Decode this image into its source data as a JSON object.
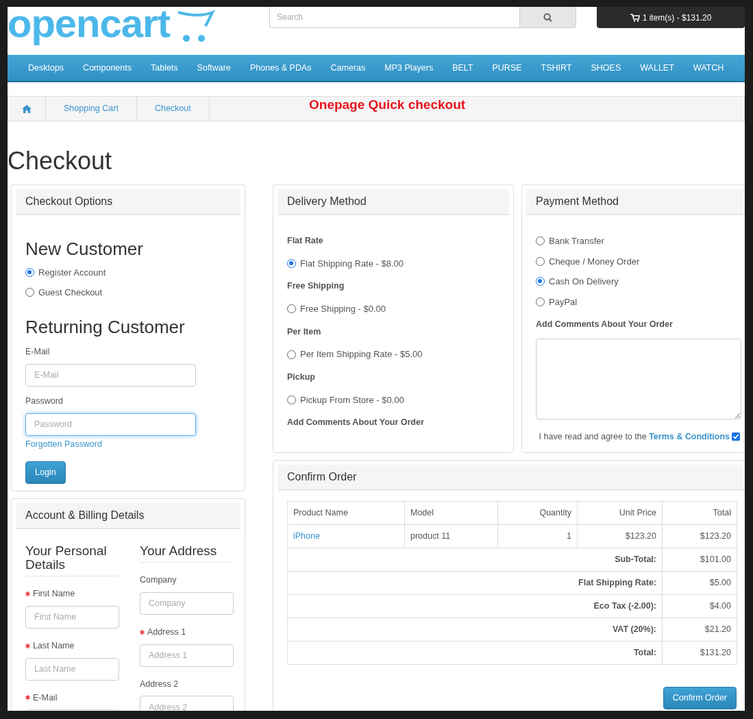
{
  "logo": {
    "text": "opencart"
  },
  "search": {
    "placeholder": "Search"
  },
  "cart": {
    "label": "1 item(s) - $131.20"
  },
  "nav": [
    "Desktops",
    "Components",
    "Tablets",
    "Software",
    "Phones & PDAs",
    "Cameras",
    "MP3 Players",
    "BELT",
    "PURSE",
    "TSHIRT",
    "SHOES",
    "WALLET",
    "WATCH"
  ],
  "breadcrumb": [
    "Shopping Cart",
    "Checkout"
  ],
  "banner": "Onepage Quick checkout",
  "page_title": "Checkout",
  "checkout_options": {
    "title": "Checkout Options",
    "new_customer": {
      "heading": "New Customer",
      "options": [
        {
          "label": "Register Account",
          "selected": true
        },
        {
          "label": "Guest Checkout",
          "selected": false
        }
      ]
    },
    "returning_customer": {
      "heading": "Returning Customer",
      "fields": [
        {
          "label": "E-Mail",
          "placeholder": "E-Mail",
          "focused": false
        },
        {
          "label": "Password",
          "placeholder": "Password",
          "focused": true
        }
      ],
      "forgotten_link": "Forgotten Password",
      "login_button": "Login"
    }
  },
  "account_billing": {
    "title": "Account & Billing Details",
    "personal": {
      "heading": "Your Personal Details",
      "fields": [
        {
          "label": "First Name",
          "placeholder": "First Name",
          "required": true
        },
        {
          "label": "Last Name",
          "placeholder": "Last Name",
          "required": true
        },
        {
          "label": "E-Mail",
          "required": true
        }
      ]
    },
    "address": {
      "heading": "Your Address",
      "fields": [
        {
          "label": "Company",
          "placeholder": "Company",
          "required": false
        },
        {
          "label": "Address 1",
          "placeholder": "Address 1",
          "required": true
        },
        {
          "label": "Address 2",
          "placeholder": "Address 2",
          "required": false
        }
      ]
    }
  },
  "delivery": {
    "title": "Delivery Method",
    "groups": [
      {
        "heading": "Flat Rate",
        "options": [
          {
            "label": "Flat Shipping Rate - $8.00",
            "selected": true
          }
        ]
      },
      {
        "heading": "Free Shipping",
        "options": [
          {
            "label": "Free Shipping - $0.00",
            "selected": false
          }
        ]
      },
      {
        "heading": "Per Item",
        "options": [
          {
            "label": "Per Item Shipping Rate - $5.00",
            "selected": false
          }
        ]
      },
      {
        "heading": "Pickup",
        "options": [
          {
            "label": "Pickup From Store - $0.00",
            "selected": false
          }
        ]
      }
    ],
    "comments_label": "Add Comments About Your Order"
  },
  "payment": {
    "title": "Payment Method",
    "options": [
      {
        "label": "Bank Transfer",
        "selected": false
      },
      {
        "label": "Cheque / Money Order",
        "selected": false
      },
      {
        "label": "Cash On Delivery",
        "selected": true
      },
      {
        "label": "PayPal",
        "selected": false
      }
    ],
    "comments_label": "Add Comments About Your Order",
    "terms": {
      "text": "I have read and agree to the",
      "link": "Terms & Conditions",
      "checked": true
    }
  },
  "confirm": {
    "title": "Confirm Order",
    "columns": [
      "Product Name",
      "Model",
      "Quantity",
      "Unit Price",
      "Total"
    ],
    "rows": [
      {
        "cells": [
          "iPhone",
          "product 11",
          "1",
          "$123.20",
          "$123.20"
        ]
      }
    ],
    "totals": [
      {
        "label": "Sub-Total:",
        "value": "$101.00"
      },
      {
        "label": "Flat Shipping Rate:",
        "value": "$5.00"
      },
      {
        "label": "Eco Tax (-2.00):",
        "value": "$4.00"
      },
      {
        "label": "VAT (20%):",
        "value": "$21.20"
      },
      {
        "label": "Total:",
        "value": "$131.20"
      }
    ],
    "button": "Confirm Order"
  }
}
